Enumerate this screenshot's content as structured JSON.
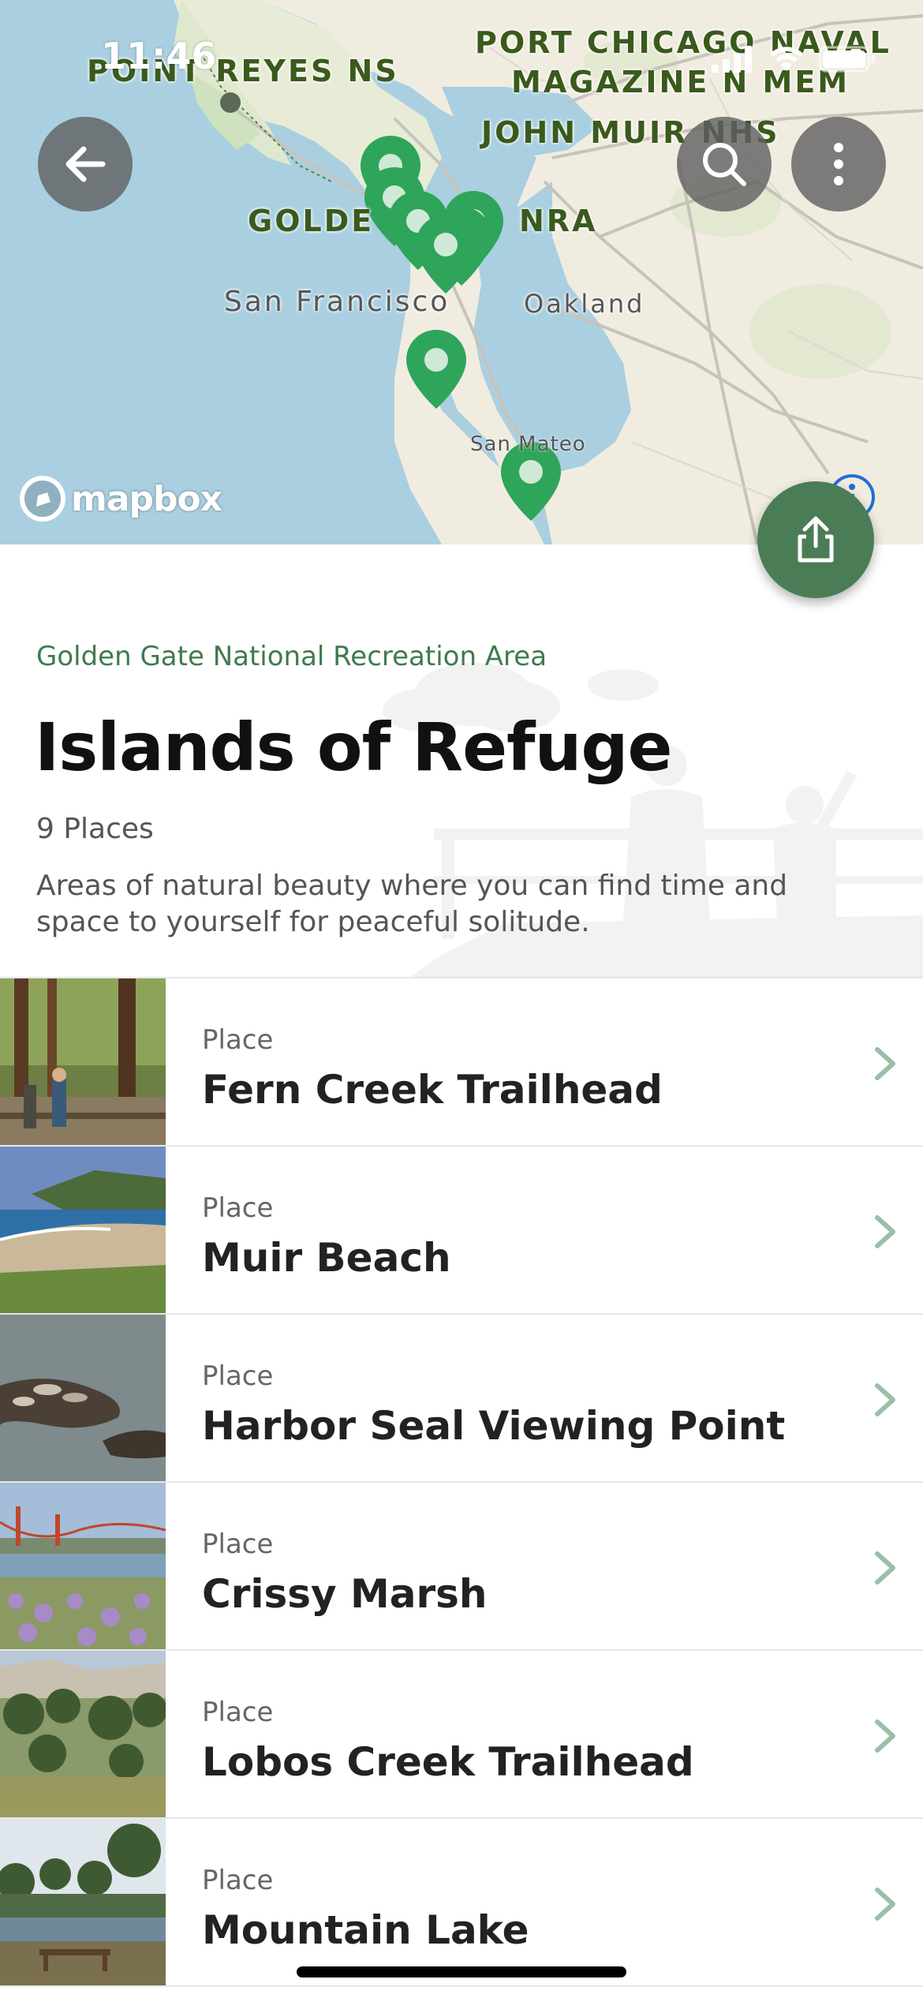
{
  "status_bar": {
    "time": "11:46"
  },
  "map": {
    "labels": {
      "point_reyes": "POINT REYES NS",
      "port_chicago_1": "PORT CHICAGO NAVAL",
      "port_chicago_2": "MAGAZINE N MEM",
      "john_muir": "JOHN MUIR NHS",
      "golden_gate_left": "GOLDE",
      "golden_gate_right": "NRA",
      "san_francisco": "San Francisco",
      "oakland": "Oakland",
      "san_mateo": "San Mateo"
    },
    "attribution": "mapbox",
    "pin_color": "#2ea55a",
    "pin_count": 9
  },
  "toolbar": {
    "back_icon": "arrow-left-icon",
    "search_icon": "search-icon",
    "more_icon": "more-vertical-icon",
    "share_icon": "share-icon"
  },
  "header": {
    "park_name": "Golden Gate National Recreation Area",
    "title": "Islands of Refuge",
    "count": "9 Places",
    "description": "Areas of natural beauty where you can find time and space to yourself for peaceful solitude."
  },
  "places": [
    {
      "kind": "Place",
      "name": "Fern Creek Trailhead"
    },
    {
      "kind": "Place",
      "name": "Muir Beach"
    },
    {
      "kind": "Place",
      "name": "Harbor Seal Viewing Point"
    },
    {
      "kind": "Place",
      "name": "Crissy Marsh"
    },
    {
      "kind": "Place",
      "name": "Lobos Creek Trailhead"
    },
    {
      "kind": "Place",
      "name": "Mountain Lake"
    }
  ],
  "colors": {
    "accent": "#3f7a4e",
    "fab": "#4a7d56",
    "chevron": "#9bbfa5",
    "water": "#a9cfe0",
    "land": "#f1ece0"
  }
}
